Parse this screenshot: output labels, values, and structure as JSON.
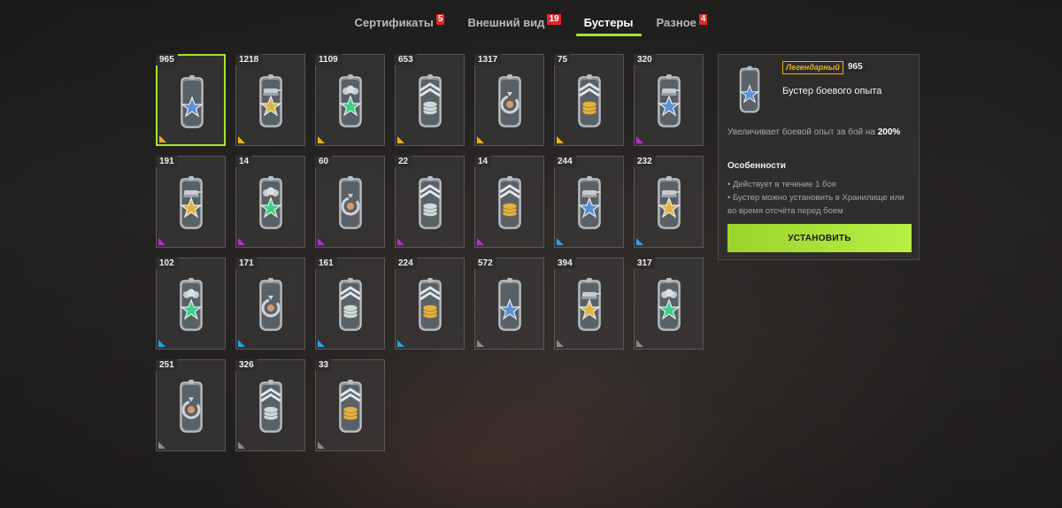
{
  "tabs": [
    {
      "label": "Сертификаты",
      "badge": "5",
      "active": false
    },
    {
      "label": "Внешний вид",
      "badge": "19",
      "active": false
    },
    {
      "label": "Бустеры",
      "badge": "",
      "active": true
    },
    {
      "label": "Разное",
      "badge": "4",
      "active": false
    }
  ],
  "colors": {
    "accent": "#a4e530",
    "legendary": "#e8b01a",
    "epic": "#b32fd0",
    "rare": "#2aa2e6",
    "common": "#8a8a8a"
  },
  "items": [
    {
      "count": "965",
      "icon": "star-icon",
      "icon_color": "#5b8fd6",
      "rarity": "legendary",
      "selected": true
    },
    {
      "count": "1218",
      "icon": "tank-star-icon",
      "icon_color": "#e0b445",
      "rarity": "legendary"
    },
    {
      "count": "1109",
      "icon": "crew-star-icon",
      "icon_color": "#3fcf8a",
      "rarity": "legendary"
    },
    {
      "count": "653",
      "icon": "coins-silver-icon",
      "icon_color": "#c9dbe2",
      "rarity": "legendary"
    },
    {
      "count": "1317",
      "icon": "research-icon",
      "icon_color": "#d99a6a",
      "rarity": "legendary"
    },
    {
      "count": "75",
      "icon": "coins-gold-icon",
      "icon_color": "#e3b13e",
      "rarity": "legendary"
    },
    {
      "count": "320",
      "icon": "tank-star-icon",
      "icon_color": "#5b8fd6",
      "rarity": "epic"
    },
    {
      "count": "191",
      "icon": "tank-star-icon",
      "icon_color": "#e0b445",
      "rarity": "epic"
    },
    {
      "count": "14",
      "icon": "crew-star-icon",
      "icon_color": "#3fcf8a",
      "rarity": "epic"
    },
    {
      "count": "60",
      "icon": "research-icon",
      "icon_color": "#d99a6a",
      "rarity": "epic"
    },
    {
      "count": "22",
      "icon": "coins-silver-icon",
      "icon_color": "#c9dbe2",
      "rarity": "epic"
    },
    {
      "count": "14",
      "icon": "coins-gold-icon",
      "icon_color": "#e3b13e",
      "rarity": "epic"
    },
    {
      "count": "244",
      "icon": "tank-star-icon",
      "icon_color": "#5b8fd6",
      "rarity": "rare"
    },
    {
      "count": "232",
      "icon": "tank-star-icon",
      "icon_color": "#e0b445",
      "rarity": "rare"
    },
    {
      "count": "102",
      "icon": "crew-star-icon",
      "icon_color": "#3fcf8a",
      "rarity": "rare"
    },
    {
      "count": "171",
      "icon": "research-icon",
      "icon_color": "#d99a6a",
      "rarity": "rare"
    },
    {
      "count": "161",
      "icon": "coins-silver-icon",
      "icon_color": "#c9dbe2",
      "rarity": "rare"
    },
    {
      "count": "224",
      "icon": "coins-gold-icon",
      "icon_color": "#e3b13e",
      "rarity": "rare"
    },
    {
      "count": "572",
      "icon": "star-icon",
      "icon_color": "#5b8fd6",
      "rarity": "common"
    },
    {
      "count": "394",
      "icon": "tank-star-icon",
      "icon_color": "#e0b445",
      "rarity": "common"
    },
    {
      "count": "317",
      "icon": "crew-star-icon",
      "icon_color": "#3fcf8a",
      "rarity": "common"
    },
    {
      "count": "251",
      "icon": "research-icon",
      "icon_color": "#d99a6a",
      "rarity": "common"
    },
    {
      "count": "326",
      "icon": "coins-silver-icon",
      "icon_color": "#c9dbe2",
      "rarity": "common"
    },
    {
      "count": "33",
      "icon": "coins-gold-icon",
      "icon_color": "#e3b13e",
      "rarity": "common"
    }
  ],
  "detail": {
    "rarity_label": "Легендарный",
    "count": "965",
    "title": "Бустер боевого опыта",
    "icon": "star-icon",
    "description_prefix": "Увеличивает боевой опыт за бой на",
    "description_value": "200%",
    "features_heading": "Особенности",
    "features": [
      "• Действует в течение 1 боя",
      "• Бустер можно установить в Хранилище или во время отсчёта перед боем"
    ],
    "install_label": "УСТАНОВИТЬ"
  }
}
